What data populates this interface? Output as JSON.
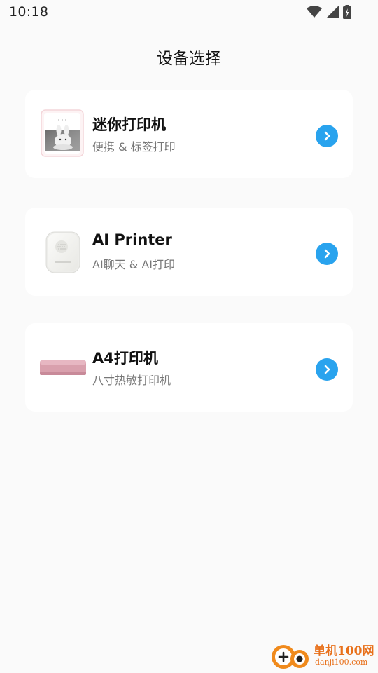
{
  "status_bar": {
    "time": "10:18"
  },
  "header": {
    "title": "设备选择"
  },
  "devices": [
    {
      "title": "迷你打印机",
      "subtitle": "便携 & 标签打印",
      "image": "mini-printer-image"
    },
    {
      "title": "AI Printer",
      "subtitle": "AI聊天 & AI打印",
      "image": "ai-printer-image"
    },
    {
      "title": "A4打印机",
      "subtitle": "八寸热敏打印机",
      "image": "a4-printer-image"
    }
  ],
  "watermark": {
    "name": "单机100网",
    "domain": "danji100.com"
  },
  "colors": {
    "accent": "#29a3ee",
    "background": "#fafafa",
    "card": "#ffffff",
    "watermark": "#e8701a"
  }
}
